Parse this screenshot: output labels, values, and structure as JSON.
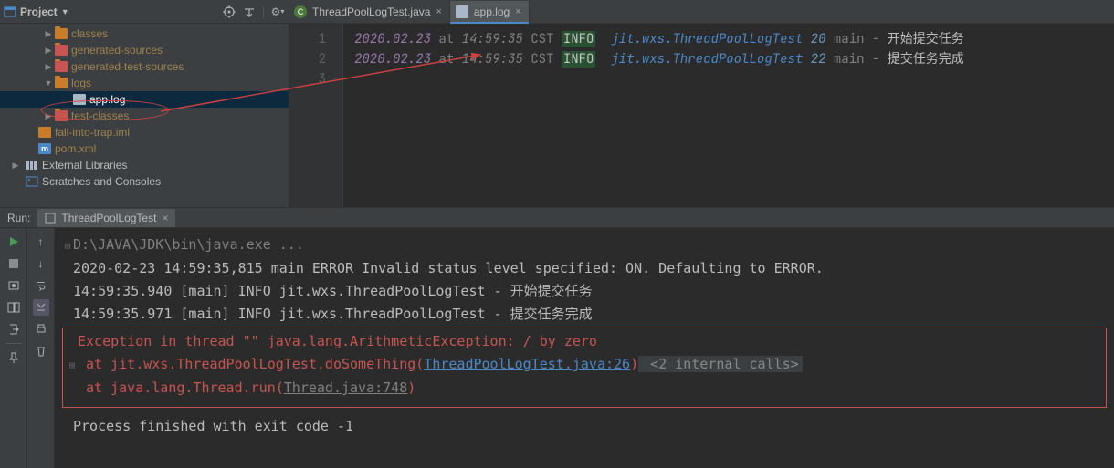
{
  "sidebar": {
    "title": "Project",
    "items": [
      {
        "label": "classes"
      },
      {
        "label": "generated-sources"
      },
      {
        "label": "generated-test-sources"
      },
      {
        "label": "logs"
      },
      {
        "label": "app.log"
      },
      {
        "label": "test-classes"
      },
      {
        "label": "fall-into-trap.iml"
      },
      {
        "label": "pom.xml"
      }
    ],
    "ext_lib": "External Libraries",
    "scratch": "Scratches and Consoles"
  },
  "tabs": [
    {
      "label": "ThreadPoolLogTest.java"
    },
    {
      "label": "app.log"
    }
  ],
  "editor_gutter": [
    "1",
    "2",
    "3"
  ],
  "log_lines": [
    {
      "date": "2020.02.23",
      "at": "at",
      "time": "14:59:35",
      "tz": "CST",
      "level": "INFO",
      "cls": "jit.wxs.ThreadPoolLogTest",
      "line": "20",
      "thread": "main",
      "dash": "-",
      "msg": "开始提交任务"
    },
    {
      "date": "2020.02.23",
      "at": "at",
      "time": "14:59:35",
      "tz": "CST",
      "level": "INFO",
      "cls": "jit.wxs.ThreadPoolLogTest",
      "line": "22",
      "thread": "main",
      "dash": "-",
      "msg": "提交任务完成"
    }
  ],
  "run": {
    "label": "Run:",
    "tab": "ThreadPoolLogTest",
    "cmd": "D:\\JAVA\\JDK\\bin\\java.exe ...",
    "line1": "2020-02-23 14:59:35,815 main ERROR Invalid status level specified: ON. Defaulting to ERROR.",
    "line2": "14:59:35.940 [main] INFO  jit.wxs.ThreadPoolLogTest - 开始提交任务",
    "line3": "14:59:35.971 [main] INFO  jit.wxs.ThreadPoolLogTest - 提交任务完成",
    "exc_head": "Exception in thread \"\" java.lang.ArithmeticException: / by zero",
    "exc_at1a": "    at jit.wxs.ThreadPoolLogTest.doSomeThing(",
    "exc_link1": "ThreadPoolLogTest.java:26",
    "exc_at1b": ")",
    "exc_extra": " <2 internal calls>",
    "exc_at2a": "    at java.lang.Thread.run(",
    "exc_link2": "Thread.java:748",
    "exc_at2b": ")",
    "finish": "Process finished with exit code -1"
  }
}
